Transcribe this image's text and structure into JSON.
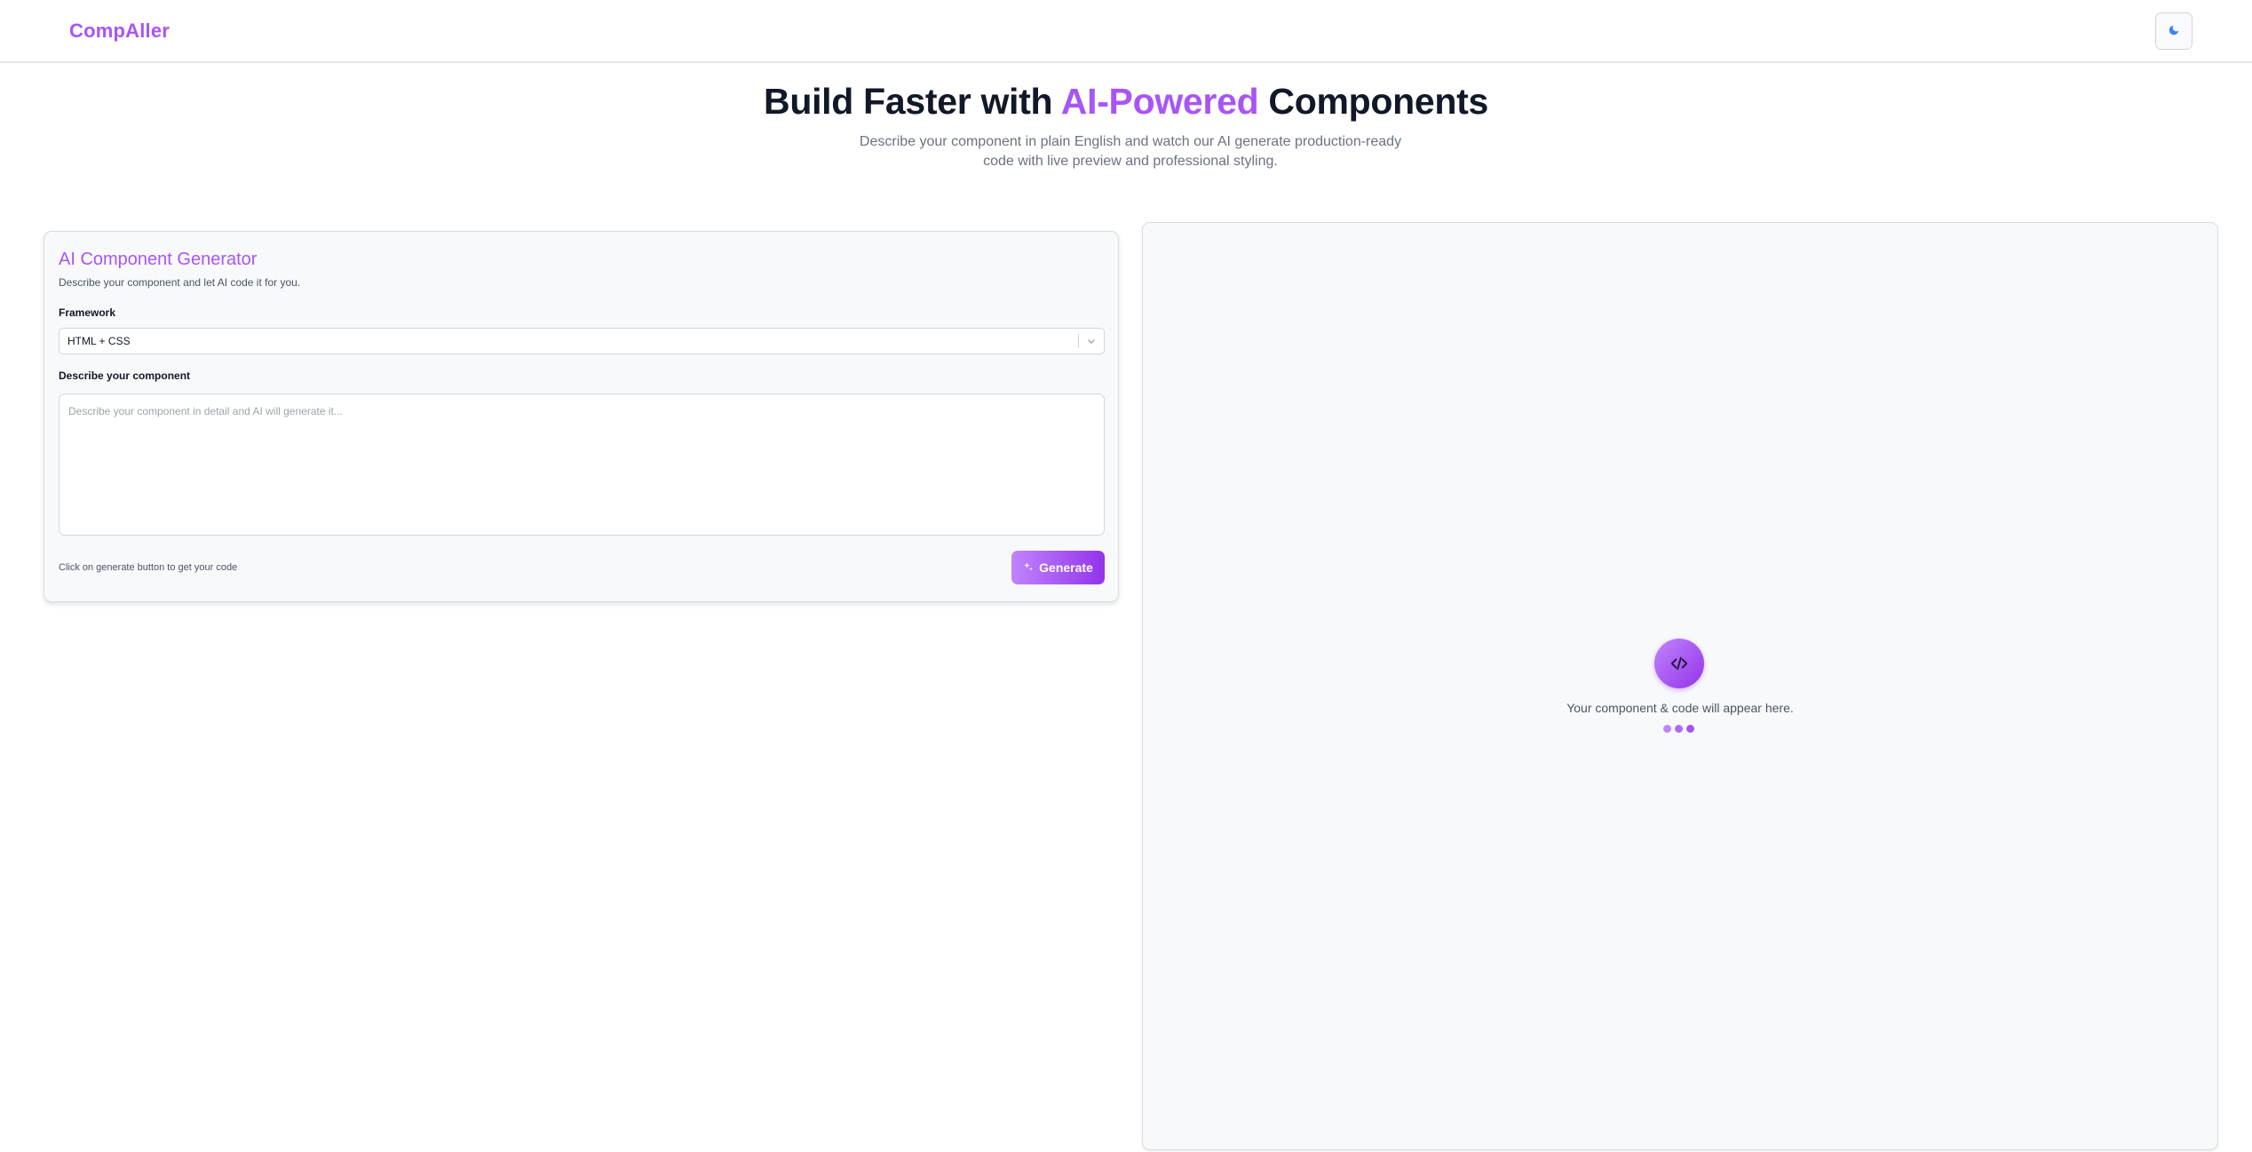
{
  "header": {
    "brand": "CompAller",
    "theme_toggle_icon": "moon-icon"
  },
  "hero": {
    "title_part1": "Build Faster with ",
    "title_accent": "AI-Powered",
    "title_part2": " Components",
    "subtitle": "Describe your component in plain English and watch our AI generate production-ready code with live preview and professional styling."
  },
  "generator": {
    "title": "AI Component Generator",
    "description": "Describe your component and let AI code it for you.",
    "framework_label": "Framework",
    "framework_value": "HTML + CSS",
    "describe_label": "Describe your component",
    "describe_placeholder": "Describe your component in detail and AI will generate it...",
    "describe_value": "",
    "hint": "Click on generate button to get your code",
    "generate_label": "Generate",
    "generate_icon": "sparkles-icon"
  },
  "preview": {
    "icon": "code-icon",
    "message": "Your component & code will appear here."
  },
  "colors": {
    "accent": "#a855f7",
    "accent_dark": "#9333ea",
    "accent_light": "#c084fc"
  }
}
